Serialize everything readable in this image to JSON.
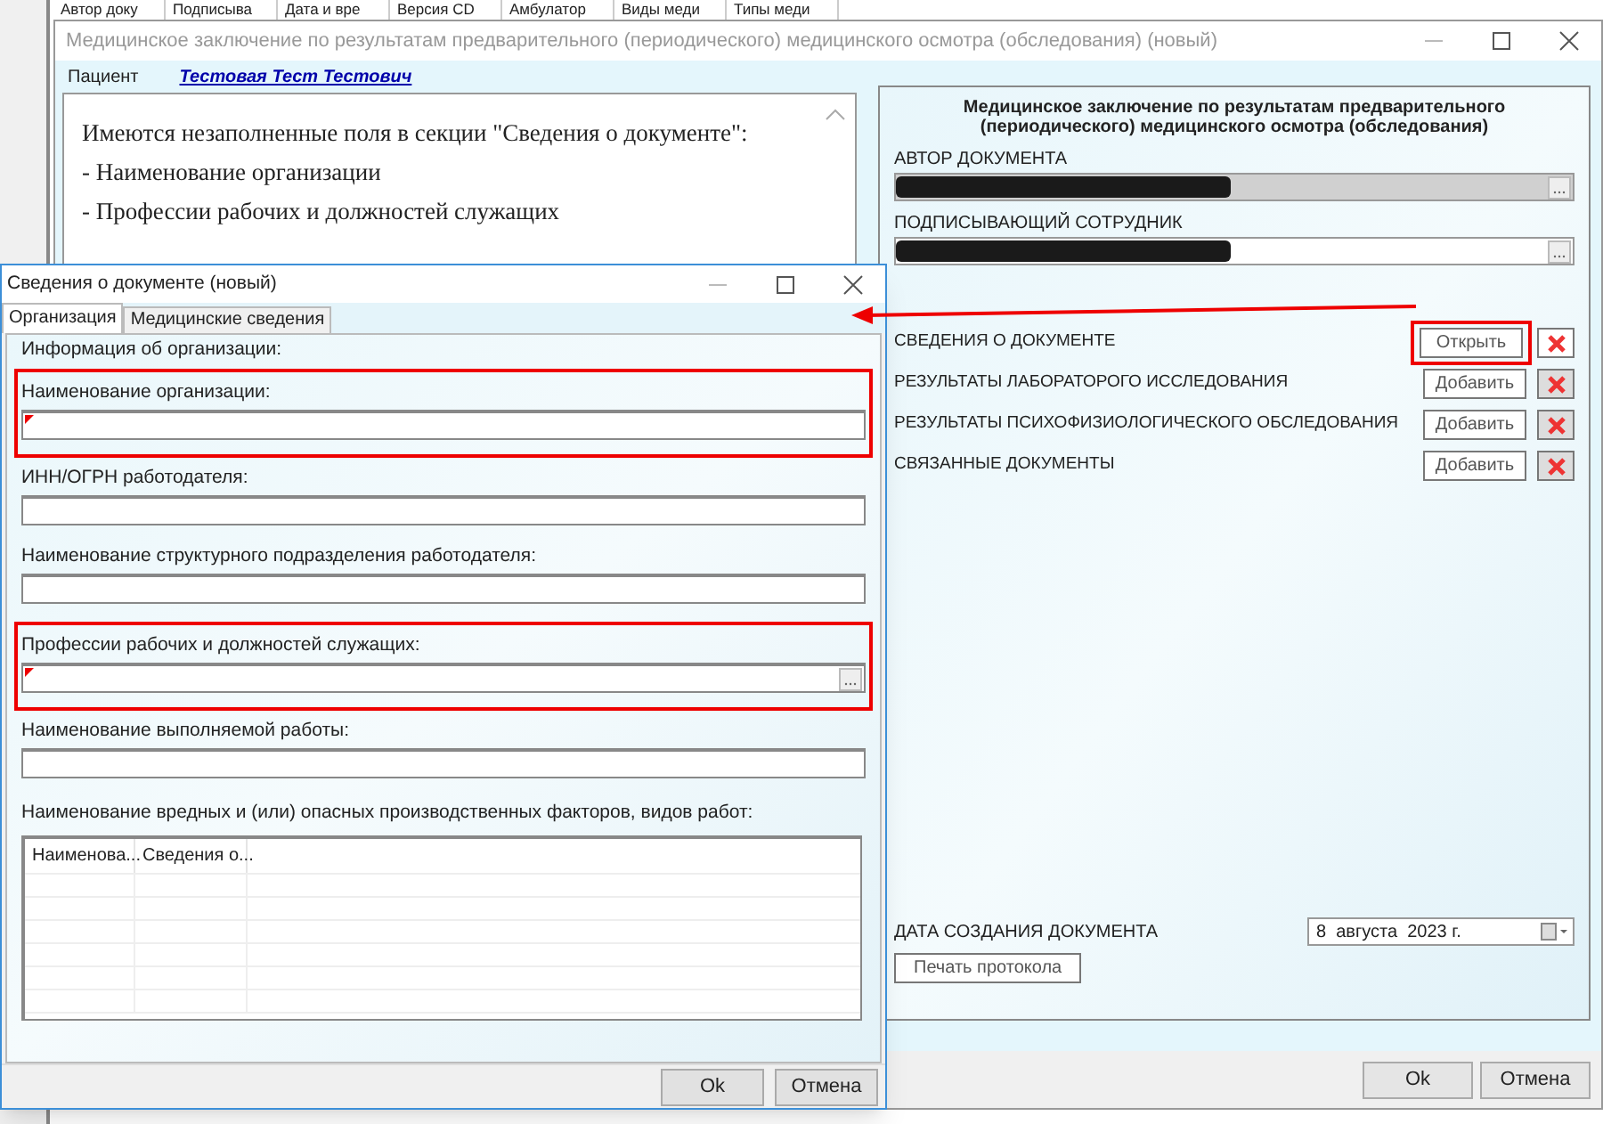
{
  "background_grid": {
    "columns": [
      "Автор доку",
      "Подписыва",
      "Дата и вре",
      "Версия CD",
      "Амбулатор",
      "Виды меди",
      "Типы меди"
    ]
  },
  "main_window": {
    "title": "Медицинское заключение по результатам предварительного (периодического) медицинского осмотра (обследования) (новый)",
    "patient_label": "Пациент",
    "patient_name": "Тестовая Тест Тестович",
    "message_lines": [
      "Имеются незаполненные поля в секции \"Сведения о документе\":",
      "- Наименование организации",
      "- Профессии рабочих и должностей служащих"
    ],
    "document": {
      "heading": "Медицинское заключение по результатам предварительного (периодического) медицинского осмотра (обследования)",
      "fields": [
        {
          "label": "АВТОР ДОКУМЕНТА",
          "redacted": true,
          "disabled": true
        },
        {
          "label": "ПОДПИСЫВАЮЩИЙ СОТРУДНИК",
          "redacted": true,
          "disabled": false
        }
      ],
      "sections": [
        {
          "label": "СВЕДЕНИЯ О ДОКУМЕНТЕ",
          "button": "Открыть",
          "highlighted": true
        },
        {
          "label": "РЕЗУЛЬТАТЫ ЛАБОРАТОРОГО ИССЛЕДОВАНИЯ",
          "button": "Добавить",
          "highlighted": false
        },
        {
          "label": "РЕЗУЛЬТАТЫ ПСИХОФИЗИОЛОГИЧЕСКОГО ОБСЛЕДОВАНИЯ",
          "button": "Добавить",
          "highlighted": false
        },
        {
          "label": "СВЯЗАННЫЕ ДОКУМЕНТЫ",
          "button": "Добавить",
          "highlighted": false
        }
      ],
      "date_label": "ДАТА СОЗДАНИЯ ДОКУМЕНТА",
      "date_value": "8  августа  2023 г.",
      "print_button": "Печать протокола"
    },
    "buttons": [
      "Ok",
      "Отмена"
    ]
  },
  "dialog": {
    "title": "Сведения о документе (новый)",
    "tabs": [
      {
        "label": "Организация",
        "selected": true
      },
      {
        "label": "Медицинские сведения",
        "selected": false
      }
    ],
    "group_label": "Информация об организации:",
    "fields": [
      {
        "label": "Наименование организации:",
        "kind": "text",
        "required": true,
        "highlighted": true
      },
      {
        "label": "ИНН/ОГРН работодателя:",
        "kind": "text",
        "required": false,
        "highlighted": false
      },
      {
        "label": "Наименование структурного подразделения работодателя:",
        "kind": "text",
        "required": false,
        "highlighted": false
      },
      {
        "label": "Профессии рабочих и должностей служащих:",
        "kind": "picker",
        "required": true,
        "highlighted": true
      },
      {
        "label": "Наименование выполняемой работы:",
        "kind": "text",
        "required": false,
        "highlighted": false
      }
    ],
    "table_label": "Наименование вредных и (или) опасных производственных факторов, видов работ:",
    "table": {
      "columns": [
        "Наименова...",
        "Сведения о..."
      ]
    },
    "buttons": [
      "Ok",
      "Отмена"
    ]
  }
}
